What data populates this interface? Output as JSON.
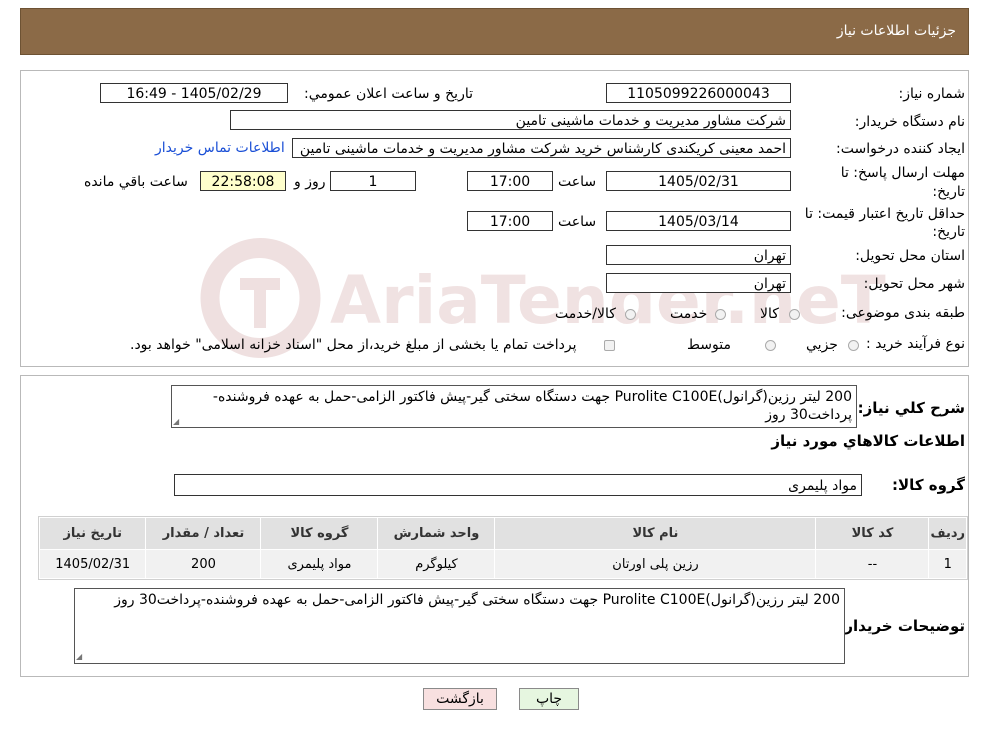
{
  "header": {
    "title": "جزئیات اطلاعات نیاز"
  },
  "watermark": {
    "text": "AriaTender.neT"
  },
  "form": {
    "need_number_label": "شماره نیاز:",
    "need_number": "1105099226000043",
    "announce_label": "تاریخ و ساعت اعلان عمومي:",
    "announce_value": "1405/02/29 - 16:49",
    "buyer_org_label": "نام دستگاه خريدار:",
    "buyer_org": "شرکت مشاور مدیریت و خدمات ماشینی تامین",
    "creator_label": "ايجاد کننده درخواست:",
    "creator": "احمد معینی کریکندی کارشناس خرید شرکت مشاور مدیریت و خدمات ماشینی تامین",
    "contact_link": "اطلاعات تماس خريدار",
    "deadline_label_1": "مهلت ارسال پاسخ: تا",
    "deadline_label_2": "تاريخ:",
    "deadline_date": "1405/02/31",
    "time_label": "ساعت",
    "deadline_time": "17:00",
    "days_value": "1",
    "days_label": "روز و",
    "remaining_time": "22:58:08",
    "remaining_label": "ساعت باقي مانده",
    "validity_label_1": "حداقل تاريخ اعتبار قيمت: تا",
    "validity_label_2": "تاريخ:",
    "validity_date": "1405/03/14",
    "validity_time": "17:00",
    "province_label": "استان محل تحويل:",
    "province": "تهران",
    "city_label": "شهر محل تحويل:",
    "city": "تهران",
    "category_label": "طبقه بندی موضوعی:",
    "category_options": [
      "کالا",
      "خدمت",
      "کالا/خدمت"
    ],
    "process_label": "نوع فرآيند خريد :",
    "process_options": [
      "جزيي",
      "متوسط"
    ],
    "process_note": "پرداخت تمام يا بخشی از مبلغ خريد،از محل \"اسناد خزانه اسلامی\" خواهد بود."
  },
  "description": {
    "label": "شرح کلي نياز:",
    "text": "200 لیتر رزین(گرانول)Purolite C100E جهت دستگاه سختی گیر-پیش فاکتور الزامی-حمل به عهده فروشنده-پرداخت30 روز",
    "items_heading": "اطلاعات کالاهاي مورد نياز",
    "group_label": "گروه کالا:",
    "group_value": "مواد پلیمری"
  },
  "table": {
    "headers": [
      "رديف",
      "کد کالا",
      "نام کالا",
      "واحد شمارش",
      "گروه کالا",
      "تعداد / مقدار",
      "تاريخ نياز"
    ],
    "rows": [
      [
        "1",
        "--",
        "رزین پلی اورتان",
        "کیلوگرم",
        "مواد پلیمری",
        "200",
        "1405/02/31"
      ]
    ]
  },
  "buyer_notes": {
    "label": "توضيحات خريدار:",
    "text": "200 لیتر رزین(گرانول)Purolite C100E جهت دستگاه سختی گیر-پیش فاکتور الزامی-حمل به عهده فروشنده-پرداخت30 روز"
  },
  "buttons": {
    "print": "چاپ",
    "back": "بازگشت"
  },
  "colors": {
    "header_bg": "#8b6a47",
    "link": "#1a4fd6",
    "back_button_bg": "#f8e0e0",
    "print_button_bg": "#e6f6e0",
    "timer_bg": "#ffffcc"
  }
}
